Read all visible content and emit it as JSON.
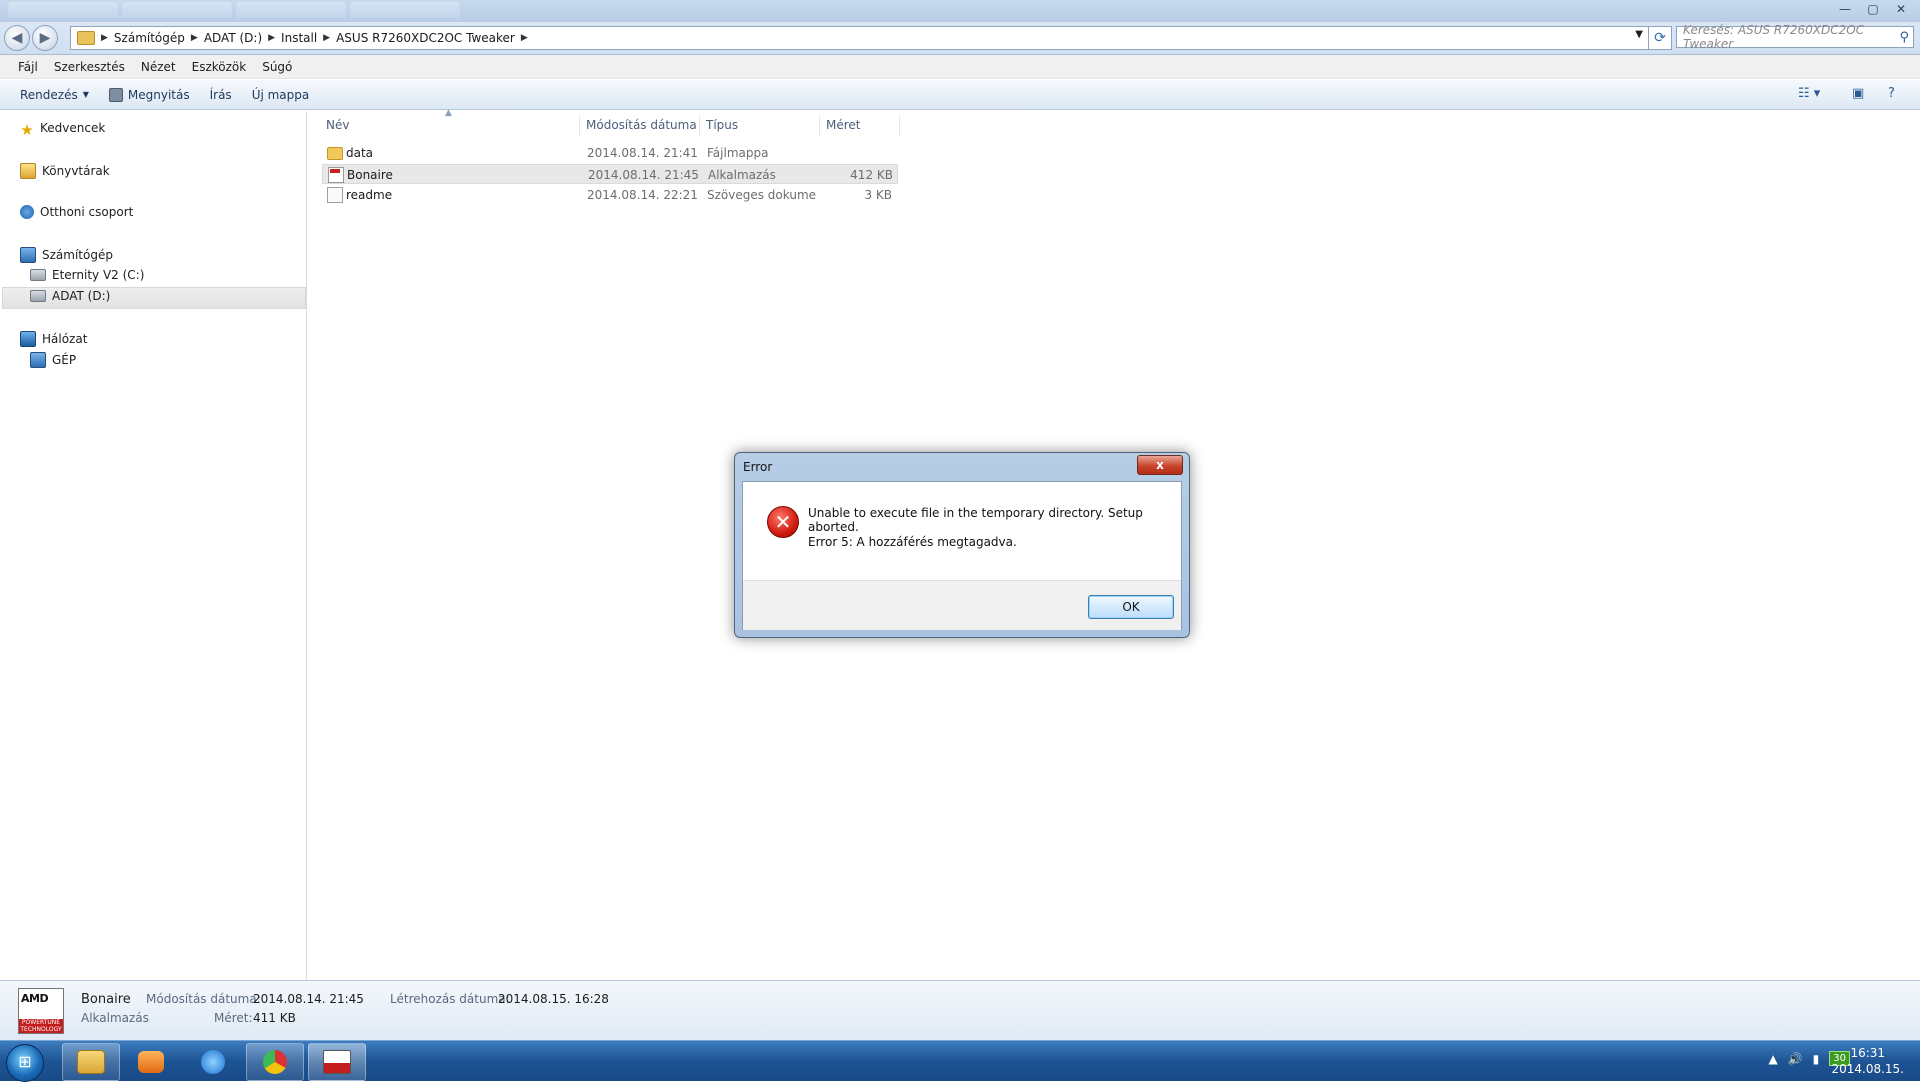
{
  "window": {
    "controls": {
      "minimize": "—",
      "maximize": "▢",
      "close": "✕"
    }
  },
  "address": {
    "crumbs": [
      "Számítógép",
      "ADAT (D:)",
      "Install",
      "ASUS R7260XDC2OC Tweaker"
    ],
    "search_placeholder": "Keresés: ASUS R7260XDC2OC Tweaker"
  },
  "menu": {
    "items": [
      "Fájl",
      "Szerkesztés",
      "Nézet",
      "Eszközök",
      "Súgó"
    ]
  },
  "commands": {
    "organize": "Rendezés",
    "open": "Megnyitás",
    "burn": "Írás",
    "new_folder": "Új mappa"
  },
  "nav": {
    "favorites": "Kedvencek",
    "libraries": "Könyvtárak",
    "homegroup": "Otthoni csoport",
    "computer": "Számítógép",
    "drive_c": "Eternity V2 (C:)",
    "drive_d": "ADAT (D:)",
    "network": "Hálózat",
    "network_pc": "GÉP"
  },
  "file_list": {
    "columns": [
      "Név",
      "Módosítás dátuma",
      "Típus",
      "Méret"
    ],
    "rows": [
      {
        "name": "data",
        "date": "2014.08.14. 21:41",
        "type": "Fájlmappa",
        "size": ""
      },
      {
        "name": "Bonaire",
        "date": "2014.08.14. 21:45",
        "type": "Alkalmazás",
        "size": "412 KB"
      },
      {
        "name": "readme",
        "date": "2014.08.14. 22:21",
        "type": "Szöveges dokume...",
        "size": "3 KB"
      }
    ]
  },
  "details": {
    "logo_top": "AMD",
    "logo_bottom": "POWERTUNE TECHNOLOGY",
    "name": "Bonaire",
    "type": "Alkalmazás",
    "modified_label": "Módosítás dátuma:",
    "modified_value": "2014.08.14. 21:45",
    "created_label": "Létrehozás dátuma:",
    "created_value": "2014.08.15. 16:28",
    "size_label": "Méret:",
    "size_value": "411 KB"
  },
  "dialog": {
    "title": "Error",
    "message": "Unable to execute file in the temporary directory. Setup aborted.",
    "detail": "Error 5: A hozzáférés megtagadva.",
    "ok_label": "OK",
    "close_label": "x"
  },
  "taskbar": {
    "tray_badge": "30",
    "clock_time": "16:31",
    "clock_date": "2014.08.15."
  }
}
